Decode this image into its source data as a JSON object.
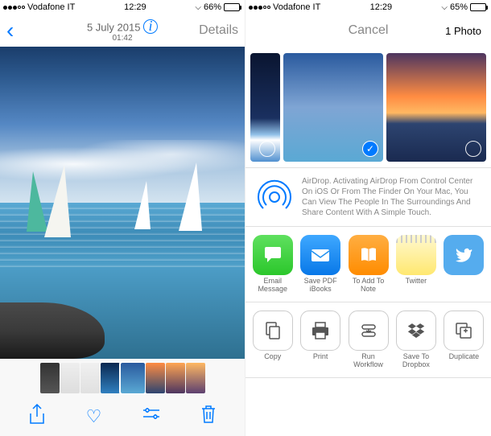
{
  "left": {
    "status": {
      "carrier": "Vodafone IT",
      "time": "12:29",
      "battery_pct": "66%",
      "battery_fill": 66
    },
    "nav": {
      "date": "5 July 2015",
      "time": "01:42",
      "details_label": "Details"
    }
  },
  "right": {
    "status": {
      "carrier": "Vodafone IT",
      "time": "12:29",
      "battery_pct": "65%",
      "battery_fill": 65
    },
    "nav": {
      "cancel_label": "Cancel",
      "count_label": "1 Photo"
    },
    "airdrop": {
      "text": "AirDrop. Activating AirDrop From Control Center On iOS Or From The Finder On Your Mac, You Can View The People In The Surroundings And Share Content With A Simple Touch."
    },
    "share_row": {
      "items": [
        {
          "label": "Email Message"
        },
        {
          "label": "Save PDF iBooks"
        },
        {
          "label": "To Add To Note"
        },
        {
          "label": "Twitter"
        }
      ]
    },
    "action_row": {
      "items": [
        {
          "label": "Copy"
        },
        {
          "label": "Print"
        },
        {
          "label": "Run Workflow"
        },
        {
          "label": "Save To Dropbox"
        },
        {
          "label": "Duplicate"
        }
      ]
    }
  }
}
